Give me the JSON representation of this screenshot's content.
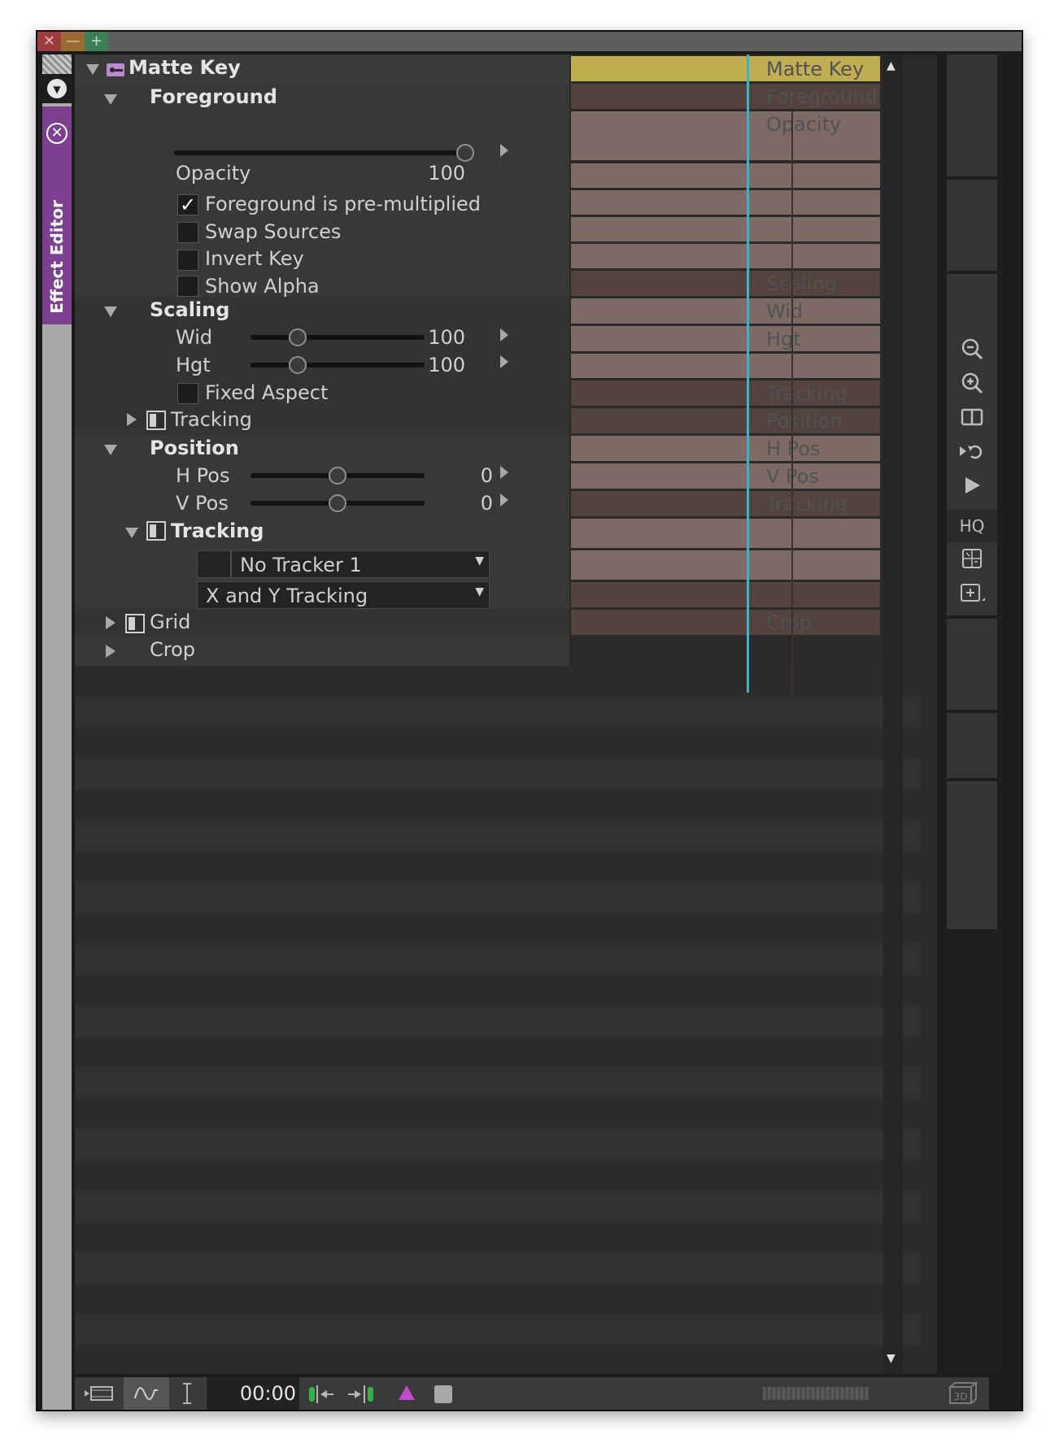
{
  "window": {
    "controls": {
      "close": "✕",
      "minimize": "—",
      "maximize": "+"
    },
    "side_tab": {
      "label": "Effect Editor"
    }
  },
  "effect": {
    "title": "Matte Key",
    "groups": {
      "foreground": {
        "label": "Foreground",
        "opacity": {
          "label": "Opacity",
          "value": "100",
          "level": 100
        },
        "checkboxes": [
          {
            "label": "Foreground is pre-multiplied",
            "checked": true
          },
          {
            "label": "Swap Sources",
            "checked": false
          },
          {
            "label": "Invert Key",
            "checked": false
          },
          {
            "label": "Show Alpha",
            "checked": false
          }
        ]
      },
      "scaling": {
        "label": "Scaling",
        "wid": {
          "label": "Wid",
          "value": "100"
        },
        "hgt": {
          "label": "Hgt",
          "value": "100"
        },
        "fixed_aspect": {
          "label": "Fixed Aspect",
          "checked": false
        },
        "tracking": {
          "label": "Tracking"
        }
      },
      "position": {
        "label": "Position",
        "hpos": {
          "label": "H Pos",
          "value": "0"
        },
        "vpos": {
          "label": "V Pos",
          "value": "0"
        },
        "tracking": {
          "label": "Tracking",
          "tracker": "No Tracker 1",
          "mode": "X and Y Tracking"
        }
      },
      "grid": {
        "label": "Grid"
      },
      "crop": {
        "label": "Crop"
      }
    }
  },
  "timeline": {
    "track_labels": [
      "Matte Key",
      "Foreground",
      "Opacity",
      "Scaling",
      "Wid",
      "Hgt",
      "Tracking",
      "Position",
      "H Pos",
      "V Pos",
      "Tracking",
      "Crop"
    ],
    "colors": {
      "header_bar": "#c2ae52",
      "group_bar": "#54423e",
      "param_bar": "#7d6a64",
      "cursor": "#3fb3c4"
    }
  },
  "tools": {
    "zoom_out": "zoom-out-icon",
    "zoom_in": "zoom-in-icon",
    "split_view": "split-view-icon",
    "reverse": "reverse-loop-icon",
    "play": "play-icon",
    "hq_label": "HQ"
  },
  "bottom_bar": {
    "timecode": "00:00",
    "badge_3d": "3D"
  }
}
